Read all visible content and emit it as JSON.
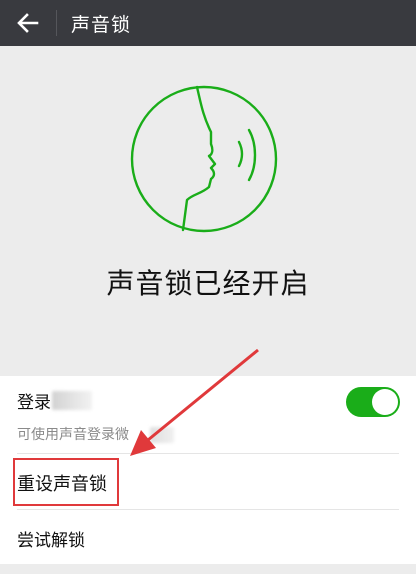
{
  "header": {
    "title": "声音锁",
    "back_icon": "back-arrow-icon"
  },
  "hero": {
    "icon": "voice-face-icon",
    "status": "声音锁已经开启",
    "accent_color": "#1aad19"
  },
  "settings": {
    "login_label": "登录",
    "login_toggle_on": true,
    "login_description": "可使用声音登录微",
    "reset_label": "重设声音锁",
    "try_unlock_label": "尝试解锁"
  },
  "annotation": {
    "highlight_color": "#e0393b"
  }
}
